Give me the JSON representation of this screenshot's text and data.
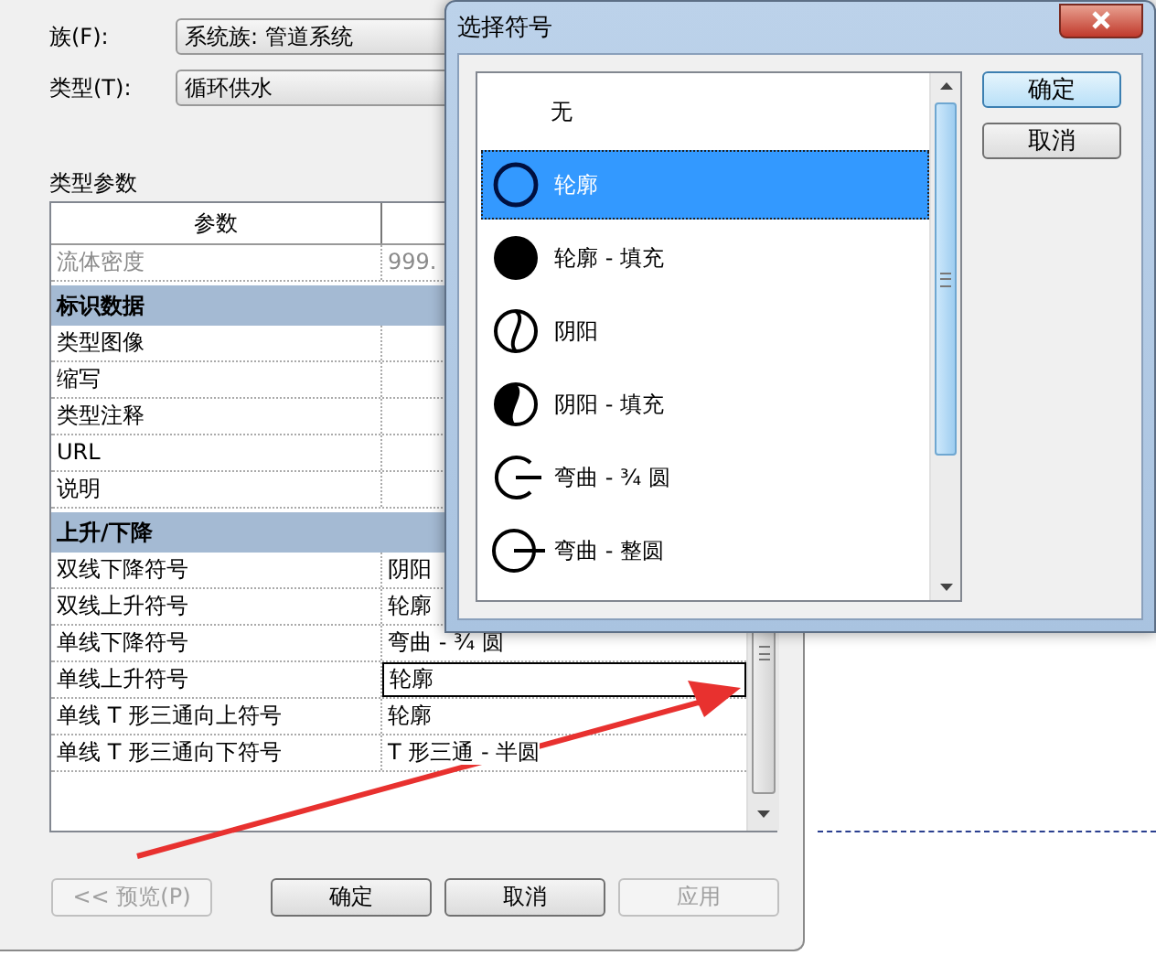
{
  "dialog": {
    "family_label": "族(F):",
    "family_value": "系统族: 管道系统",
    "type_label": "类型(T):",
    "type_value": "循环供水",
    "section_title": "类型参数",
    "table": {
      "columns": [
        "参数"
      ],
      "rows": [
        {
          "kind": "param",
          "name": "流体密度",
          "value": "999.",
          "disabled": true,
          "selected": false
        },
        {
          "kind": "group",
          "name": "标识数据"
        },
        {
          "kind": "param",
          "name": "类型图像",
          "disabled": false,
          "selected": false
        },
        {
          "kind": "param",
          "name": "缩写",
          "disabled": false,
          "selected": false
        },
        {
          "kind": "param",
          "name": "类型注释",
          "disabled": false,
          "selected": false
        },
        {
          "kind": "param",
          "name": "URL",
          "disabled": false,
          "selected": false
        },
        {
          "kind": "param",
          "name": "说明",
          "disabled": false,
          "selected": false
        },
        {
          "kind": "group",
          "name": "上升/下降"
        },
        {
          "kind": "param",
          "name": "双线下降符号",
          "value": "阴阳",
          "disabled": false,
          "selected": false
        },
        {
          "kind": "param",
          "name": "双线上升符号",
          "value": "轮廓",
          "disabled": false,
          "selected": false
        },
        {
          "kind": "param",
          "name": "单线下降符号",
          "value": "弯曲 - ¾ 圆",
          "disabled": false,
          "selected": false
        },
        {
          "kind": "param",
          "name": "单线上升符号",
          "value": "轮廓",
          "disabled": false,
          "selected": true
        },
        {
          "kind": "param",
          "name": "单线 T 形三通向上符号",
          "value": "轮廓",
          "disabled": false,
          "selected": false
        },
        {
          "kind": "param",
          "name": "单线 T 形三通向下符号",
          "value": "T 形三通 - 半圆",
          "disabled": false,
          "selected": false
        }
      ]
    },
    "buttons": [
      {
        "label": "<< 预览(P)",
        "disabled": true
      },
      {
        "label": "确定",
        "disabled": false
      },
      {
        "label": "取消",
        "disabled": false
      },
      {
        "label": "应用",
        "disabled": true
      }
    ]
  },
  "symbol_dialog": {
    "title": "选择符号",
    "symbols": [
      {
        "label": "无",
        "kind": "none",
        "selected": false
      },
      {
        "label": "轮廓",
        "kind": "outline",
        "selected": true
      },
      {
        "label": "轮廓 - 填充",
        "kind": "outline-fill",
        "selected": false
      },
      {
        "label": "阴阳",
        "kind": "yinyang",
        "selected": false
      },
      {
        "label": "阴阳 - 填充",
        "kind": "yinyang-fill",
        "selected": false
      },
      {
        "label": "弯曲 - ¾ 圆",
        "kind": "bend-three-quarter",
        "selected": false
      },
      {
        "label": "弯曲 - 整圆",
        "kind": "bend-full",
        "selected": false
      }
    ],
    "buttons": [
      {
        "label": "确定",
        "default": true
      },
      {
        "label": "取消",
        "default": false
      }
    ]
  }
}
